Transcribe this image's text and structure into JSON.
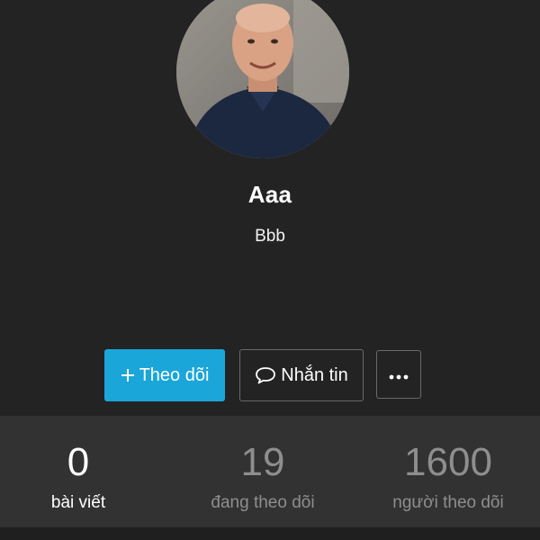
{
  "profile": {
    "name": "Aaa",
    "bio": "Bbb"
  },
  "actions": {
    "follow_label": "Theo dõi",
    "follow_icon": "plus-icon",
    "message_label": "Nhắn tin",
    "message_icon": "chat-bubble-icon",
    "more_icon": "more-dots-icon"
  },
  "stats": [
    {
      "value": "0",
      "label": "bài viết"
    },
    {
      "value": "19",
      "label": "đang theo dõi"
    },
    {
      "value": "1600",
      "label": "người theo dõi"
    }
  ],
  "colors": {
    "background": "#232323",
    "stats_bar": "#323232",
    "accent": "#1aa6d9",
    "muted_text": "#8e8e8e"
  }
}
